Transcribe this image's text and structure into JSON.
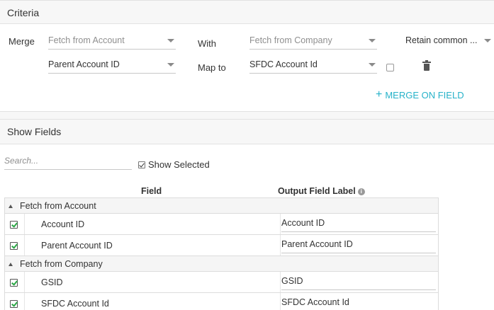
{
  "criteria": {
    "title": "Criteria",
    "merge_label": "Merge",
    "with_label": "With",
    "map_to_label": "Map to",
    "merge_source": "Fetch from Account",
    "with_source": "Fetch from Company",
    "retain_option": "Retain common ...",
    "left_field": "Parent Account ID",
    "right_field": "SFDC Account Id",
    "merge_on_field_label": "MERGE ON FIELD"
  },
  "show_fields": {
    "title": "Show Fields",
    "search_placeholder": "Search...",
    "show_selected_label": "Show Selected",
    "columns": {
      "field": "Field",
      "output_label": "Output Field Label"
    },
    "groups": [
      {
        "name": "Fetch from Account",
        "rows": [
          {
            "field": "Account ID",
            "output": "Account ID",
            "checked": true
          },
          {
            "field": "Parent Account ID",
            "output": "Parent Account ID",
            "checked": true
          }
        ]
      },
      {
        "name": "Fetch from Company",
        "rows": [
          {
            "field": "GSID",
            "output": "GSID",
            "checked": true
          },
          {
            "field": "SFDC Account Id",
            "output": "SFDC Account Id",
            "checked": true
          }
        ]
      }
    ]
  },
  "colors": {
    "accent": "#26b2c9",
    "check_green": "#2aa745",
    "header_bg": "#f7f7f7"
  },
  "icons": [
    "caret-down-icon",
    "trash-icon",
    "plus-icon",
    "info-icon",
    "expand-triangle-icon",
    "checkbox-icon"
  ]
}
